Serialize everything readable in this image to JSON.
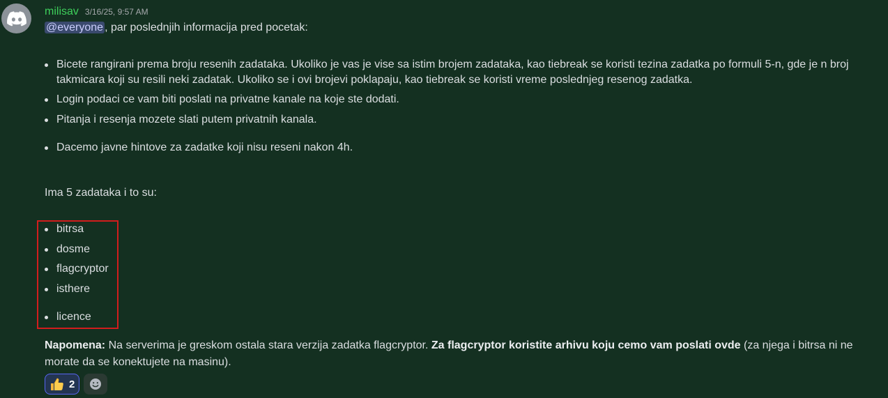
{
  "message": {
    "author": "milisav",
    "timestamp": "3/16/25, 9:57 AM",
    "mention": "@everyone",
    "intro_rest": ", par poslednjih informacija pred pocetak:",
    "rules": [
      "Bicete rangirani prema broju resenih zadataka. Ukoliko je vas je vise sa istim brojem zadataka, kao tiebreak se koristi tezina zadatka po formuli 5-n, gde je n broj takmicara koji su resili neki zadatak. Ukoliko se i ovi brojevi poklapaju, kao tiebreak se koristi vreme poslednjeg resenog zadatka.",
      "Login podaci ce vam biti poslati na privatne kanale na koje ste dodati.",
      "Pitanja i resenja mozete slati putem privatnih kanala.",
      "Dacemo javne hintove za zadatke koji nisu reseni nakon 4h."
    ],
    "tasks_intro": "Ima 5 zadataka i to su:",
    "tasks": [
      "bitrsa",
      "dosme",
      "flagcryptor",
      "isthere",
      "licence"
    ],
    "note": {
      "label": "Napomena:",
      "text": " Na serverima je greskom ostala stara verzija zadatka flagcryptor. ",
      "bold_text": "Za flagcryptor koristite arhivu koju cemo vam poslati ovde",
      "tail": " (za njega i bitrsa ni ne morate da se konektujete na masinu)."
    }
  },
  "reactions": [
    {
      "icon": "thumbs-up-icon",
      "count": "2"
    }
  ],
  "colors": {
    "background": "#143021",
    "username": "#3ecf5b",
    "highlight": "#d21d1d",
    "mention_bg": "#3a4a6e"
  }
}
